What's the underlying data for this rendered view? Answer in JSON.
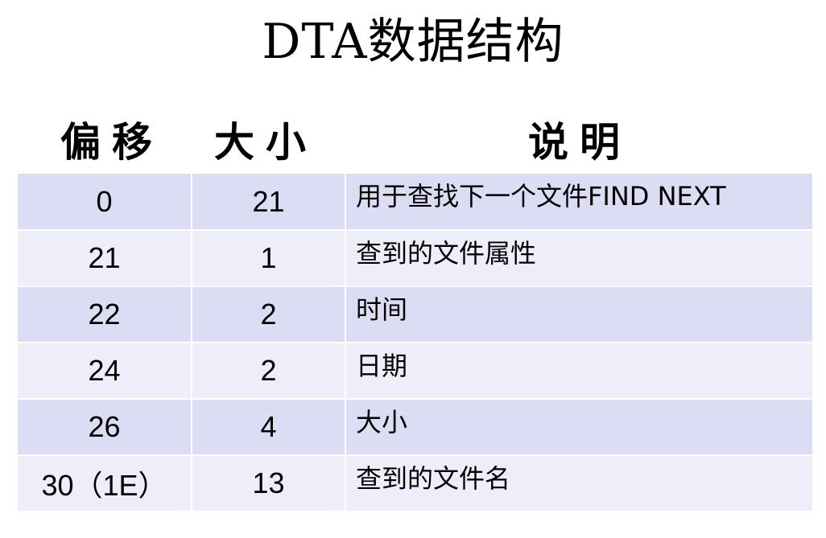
{
  "title": "DTA数据结构",
  "headers": {
    "offset": "偏移",
    "size": "大小",
    "description": "说明"
  },
  "rows": [
    {
      "offset": "0",
      "size": "21",
      "description": "用于查找下一个文件FIND NEXT"
    },
    {
      "offset": "21",
      "size": "1",
      "description": "查到的文件属性"
    },
    {
      "offset": "22",
      "size": "2",
      "description": "时间"
    },
    {
      "offset": "24",
      "size": "2",
      "description": "日期"
    },
    {
      "offset": "26",
      "size": "4",
      "description": "大小"
    },
    {
      "offset": "30（1E）",
      "size": "13",
      "description": "查到的文件名"
    }
  ],
  "colors": {
    "row_dark": "#dcdcf4",
    "row_light": "#eeeefa",
    "text": "#000000"
  }
}
